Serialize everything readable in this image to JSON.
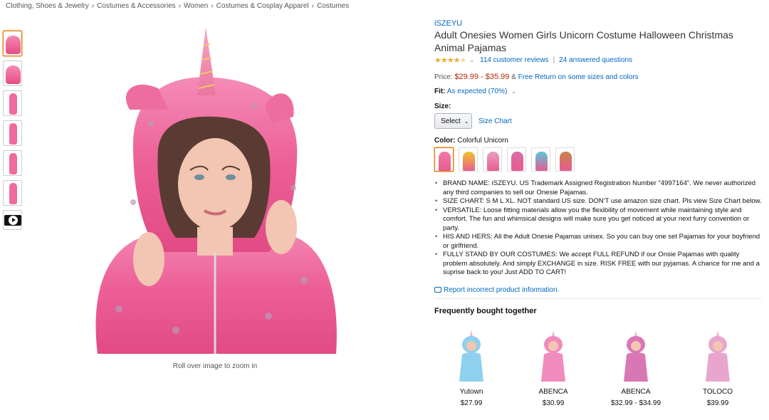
{
  "breadcrumb": [
    "Clothing, Shoes & Jewelry",
    "Costumes & Accessories",
    "Women",
    "Costumes & Cosplay Apparel",
    "Costumes"
  ],
  "breadcrumb_separator": "›",
  "thumbnails": [
    {
      "name": "thumb-1",
      "kind": "image"
    },
    {
      "name": "thumb-2",
      "kind": "image"
    },
    {
      "name": "thumb-3",
      "kind": "image"
    },
    {
      "name": "thumb-4",
      "kind": "image"
    },
    {
      "name": "thumb-5",
      "kind": "image"
    },
    {
      "name": "thumb-6",
      "kind": "image"
    },
    {
      "name": "thumb-video",
      "kind": "video",
      "icon": "play-icon"
    }
  ],
  "image_hint": "Roll over image to zoom in",
  "product": {
    "brand": "iSZEYU",
    "title": "Adult Onesies Women Girls Unicorn Costume Halloween Christmas Animal Pajamas",
    "rating": 4.0,
    "reviews": "114 customer reviews",
    "questions": "24 answered questions",
    "price_label": "Price:",
    "price_range": "$29.99 - $35.99",
    "return_amp": "&",
    "return_text": "Free Return on some sizes and colors",
    "fit_label": "Fit:",
    "fit_value": "As expected (70%)",
    "size_label": "Size:",
    "size_select": "Select",
    "size_chart": "Size Chart",
    "color_label": "Color:",
    "color_value": "Colorful Unicorn",
    "swatch_colors": [
      "#f07aa8",
      "#f2c22e",
      "#e9a0c0",
      "#d66fa7",
      "#5bc7d9",
      "#c9834a"
    ],
    "bullets": [
      "BRAND NAME: iSZEYU. US Trademark Assigned Registration Number \"4997164\". We never authorized any third companies to sell our Onesie Pajamas.",
      "SIZE CHART: S M L XL. NOT standard US size. DON'T use amazon size chart. Pls view Size Chart below.",
      "VERSATILE: Loose fitting materials allow you the flexibility of movement while maintaining style and comfort. The fun and whimsical designs will make sure you get noticed at your next furry convention or party.",
      "HIS AND HERS: All the Adult Onesie Pajamas unisex. So you can buy one set Pajamas for your boyfriend or girlfriend.",
      "FULLY STAND BY OUR COSTUMES: We accept FULL REFUND if our Onsie Pajamas with quality problem absolutely. And simply EXCHANGE in size. RISK FREE with our pyjamas. A chance for me and a suprise back to you! Just ADD TO CART!"
    ],
    "report_link": "Report incorrect product information."
  },
  "fbt": {
    "heading": "Frequently bought together",
    "items": [
      {
        "brand": "Yutown",
        "price": "$27.99",
        "color": "#8fd0ee"
      },
      {
        "brand": "ABENCA",
        "price": "$30.99",
        "color": "#f18bbd"
      },
      {
        "brand": "ABENCA",
        "price": "$32.99 - $34.99",
        "color": "#d977b4"
      },
      {
        "brand": "TOLOCO",
        "price": "$39.99",
        "color": "#e8a6cf"
      }
    ]
  }
}
